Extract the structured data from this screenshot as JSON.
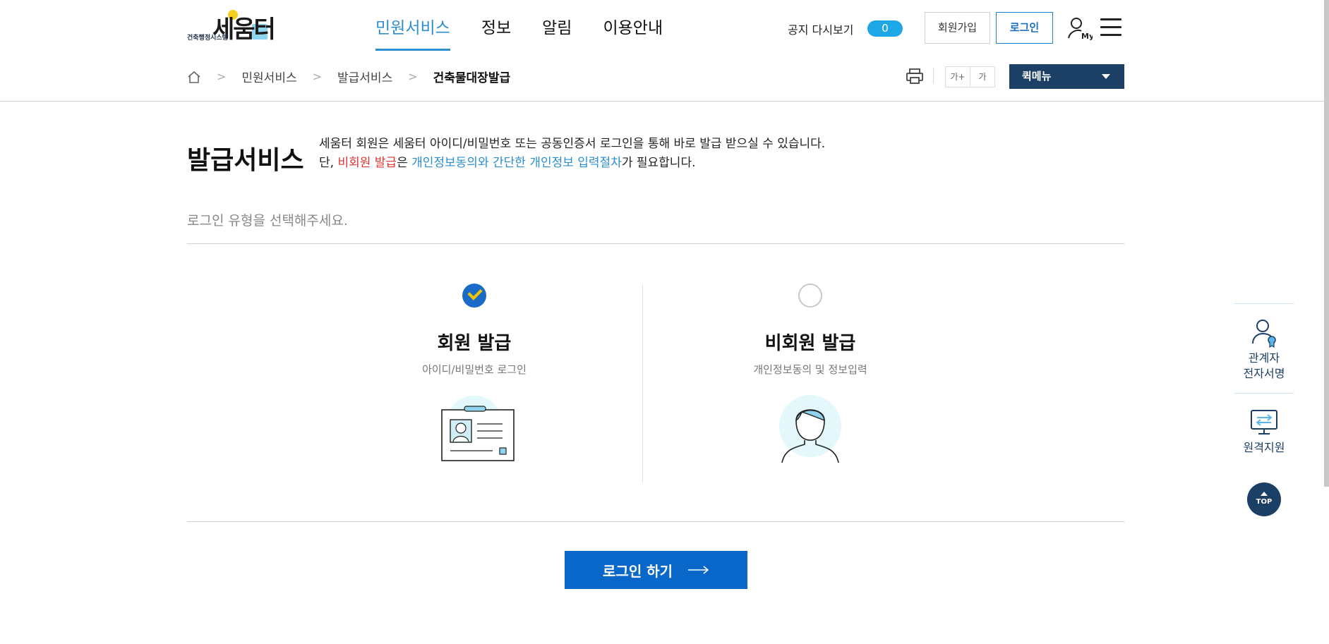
{
  "header": {
    "logo": {
      "sub": "건축행정시스템",
      "main": "세움터"
    },
    "nav": [
      "민원서비스",
      "정보",
      "알림",
      "이용안내"
    ],
    "notice_label": "공지 다시보기",
    "notice_count": "0",
    "join_label": "회원가입",
    "login_label": "로그인"
  },
  "breadcrumb": {
    "items": [
      "민원서비스",
      "발급서비스"
    ],
    "current": "건축물대장발급"
  },
  "font_controls": [
    "가+",
    "가"
  ],
  "quickmenu": "퀵메뉴",
  "main": {
    "title": "발급서비스",
    "desc_line1": "세움터 회원은 세움터 아이디/비밀번호 또는 공동인증서 로그인을 통해 바로 발급 받으실 수 있습니다.",
    "desc_line2": {
      "prefix": "단, ",
      "red": "비회원 발급",
      "mid": "은 ",
      "blue": "개인정보동의와 간단한 개인정보 입력절차",
      "suffix": "가 필요합니다."
    },
    "subtitle": "로그인 유형을 선택해주세요.",
    "options": [
      {
        "title": "회원 발급",
        "sub": "아이디/비밀번호 로그인",
        "selected": true
      },
      {
        "title": "비회원 발급",
        "sub": "개인정보동의 및 정보입력",
        "selected": false
      }
    ],
    "login_button": "로그인 하기"
  },
  "side": {
    "items": [
      {
        "line1": "관계자",
        "line2": "전자서명"
      },
      {
        "line1": "원격지원",
        "line2": ""
      }
    ],
    "top_label": "TOP"
  },
  "colors": {
    "primary": "#0867c9",
    "nav_active": "#2e8fd0",
    "navy": "#1c3f66",
    "red": "#e03434"
  }
}
